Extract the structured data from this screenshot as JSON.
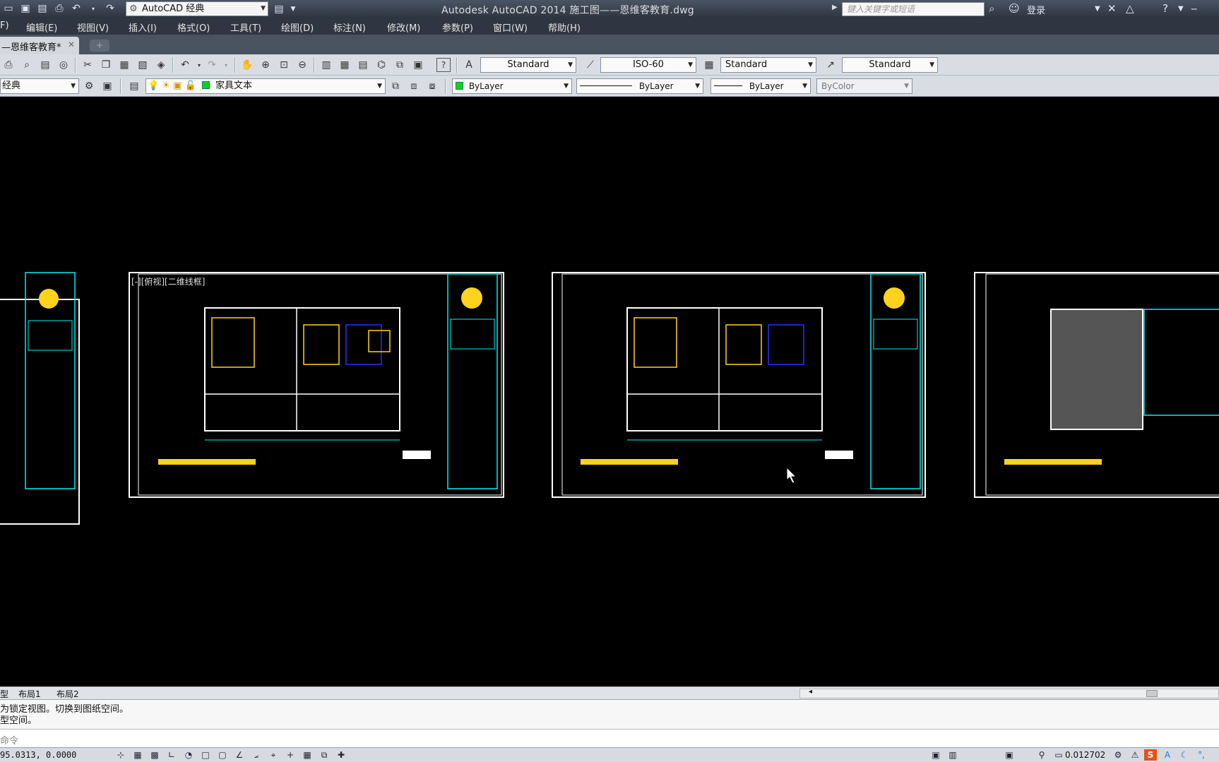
{
  "titlebar": {
    "workspace": "AutoCAD 经典",
    "title": "Autodesk AutoCAD 2014    施工图——恩维客教育.dwg",
    "search_placeholder": "键入关键字或短语",
    "login": "登录"
  },
  "menu": [
    "F)",
    "编辑(E)",
    "视图(V)",
    "插入(I)",
    "格式(O)",
    "工具(T)",
    "绘图(D)",
    "标注(N)",
    "修改(M)",
    "参数(P)",
    "窗口(W)",
    "帮助(H)"
  ],
  "document_tab": "—恩维客教育*",
  "styles_toolbar": {
    "text_style": "Standard",
    "dim_style": "ISO-60",
    "table_style": "Standard",
    "mleader_style": "Standard"
  },
  "layers_toolbar": {
    "workspace_fragment": "经典",
    "current_layer": "家具文本",
    "color": "ByLayer",
    "linetype": "ByLayer",
    "lineweight": "ByLayer",
    "plotstyle": "ByColor"
  },
  "viewport_label": "[-][俯视][二维线框]",
  "layout_tabs": [
    "型",
    "布局1",
    "布局2"
  ],
  "command_history": [
    "为锁定视图。切换到图纸空间。",
    "型空间。"
  ],
  "command_prompt": "命令",
  "status": {
    "coordinates": "95.0313,  0.0000",
    "scale": "0.012702"
  },
  "colors": {
    "frame": "#ffffff",
    "cyan": "#00e5e5",
    "yellow": "#ffd21e",
    "canvas": "#000000"
  }
}
